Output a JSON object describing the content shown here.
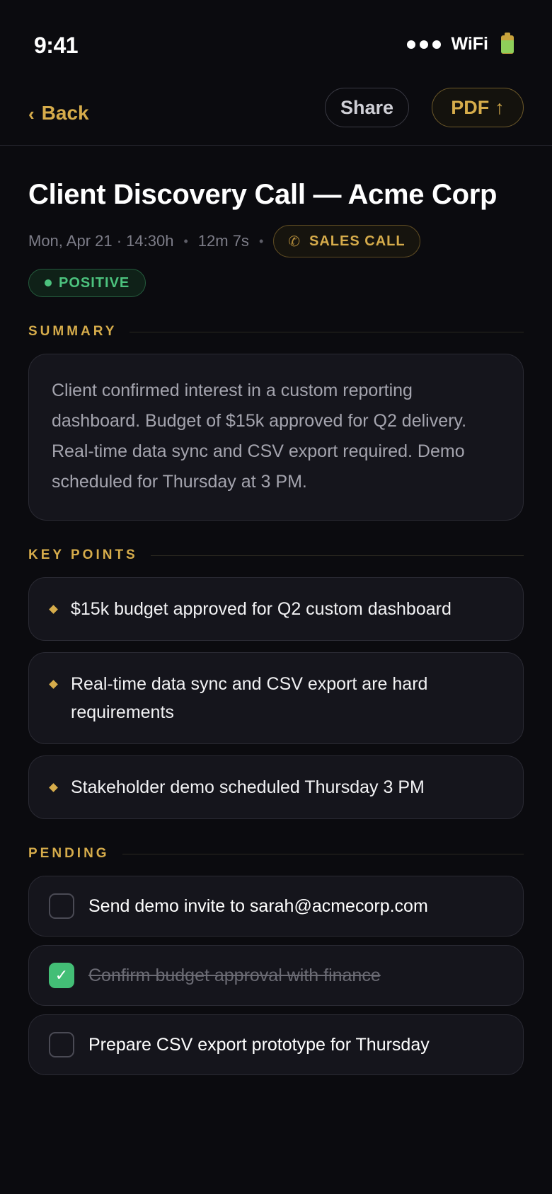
{
  "status_bar": {
    "time": "9:41",
    "network": "WiFi"
  },
  "nav": {
    "back_label": "Back",
    "share_label": "Share",
    "pdf_label": "PDF",
    "pdf_icon": "↑"
  },
  "call": {
    "title": "Client Discovery Call — Acme Corp",
    "date": "Mon, Apr 21 · 14:30h",
    "duration": "12m 7s",
    "type_label": "SALES CALL",
    "sentiment_label": "POSITIVE"
  },
  "summary": {
    "heading": "SUMMARY",
    "text": "Client confirmed interest in a custom reporting dashboard. Budget of $15k approved for Q2 delivery. Real-time data sync and CSV export required. Demo scheduled for Thursday at 3 PM."
  },
  "key_points": {
    "heading": "KEY POINTS",
    "items": [
      "$15k budget approved for Q2 custom dashboard",
      "Real-time data sync and CSV export are hard requirements",
      "Stakeholder demo scheduled Thursday 3 PM"
    ]
  },
  "pending": {
    "heading": "PENDING",
    "items": [
      {
        "label": "Send demo invite to sarah@acmecorp.com",
        "done": false
      },
      {
        "label": "Confirm budget approval with finance",
        "done": true
      },
      {
        "label": "Prepare CSV export prototype for Thursday",
        "done": false
      }
    ]
  },
  "colors": {
    "accent": "#d6ac4b",
    "positive": "#4cc27e",
    "background": "#0b0b0f",
    "card": "#15151c"
  }
}
